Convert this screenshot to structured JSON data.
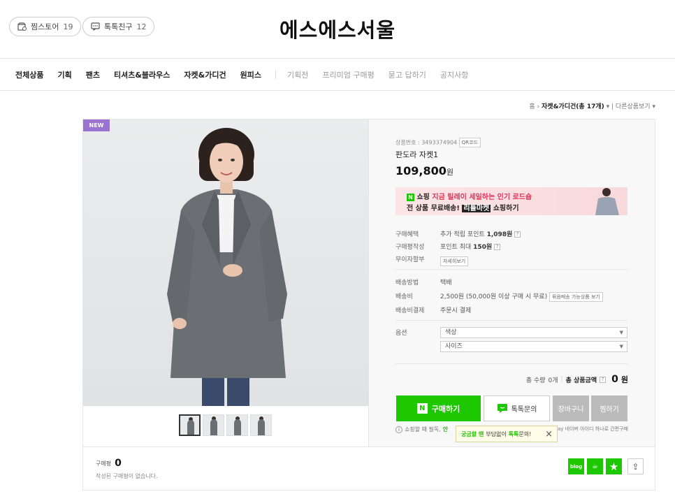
{
  "header": {
    "store_title": "에스에스서울",
    "pills": [
      {
        "label": "찜스토어",
        "count": "19",
        "icon": "store-icon"
      },
      {
        "label": "톡톡친구",
        "count": "12",
        "icon": "talk-icon"
      }
    ]
  },
  "nav": {
    "items": [
      "전체상품",
      "기획",
      "팬츠",
      "티셔츠&블라우스",
      "자켓&가디건",
      "원피스"
    ],
    "sub_items": [
      "기획전",
      "프리미엄 구매평",
      "묻고 답하기",
      "공지사항"
    ]
  },
  "breadcrumb": {
    "home": "홈",
    "category": "자켓&가디건(총",
    "count": "17개)",
    "other": "다른상품보기"
  },
  "gallery": {
    "badge": "NEW",
    "thumbnail_count": 4,
    "selected_thumbnail": 1
  },
  "product": {
    "number_label": "상품번호 : 3493374904",
    "qr_label": "QR코드",
    "name": "판도라 자켓1",
    "price": "109,800",
    "price_unit": "원"
  },
  "banner": {
    "line1_prefix": "쇼핑",
    "line1_highlight": "지금 릴레이 세일하는 인기 로드숍",
    "line2_prefix": "전 상품 무료배송!",
    "line2_highlight": "리틀마켓",
    "line2_suffix": "쇼핑하기"
  },
  "benefits": [
    {
      "label": "구매혜택",
      "text": "추가 적립 포인트",
      "bold": "1,098원",
      "help": "?"
    },
    {
      "label": "구매평작성",
      "text": "포인트 최대",
      "bold": "150원",
      "help": "?"
    },
    {
      "label": "무이자할부",
      "button": "자세히보기"
    }
  ],
  "shipping": [
    {
      "label": "배송방법",
      "text": "택배"
    },
    {
      "label": "배송비",
      "text": "2,500원 (50,000원 이상 구매 시 무료)",
      "button": "묶음배송 가능상품 보기"
    },
    {
      "label": "배송비결제",
      "text": "주문시 결제"
    }
  ],
  "options": {
    "label": "옵션",
    "selects": [
      "색상",
      "사이즈"
    ]
  },
  "totals": {
    "qty_label": "총 수량",
    "qty": "0개",
    "amount_label": "총 상품금액",
    "help": "?",
    "amount": "0",
    "amount_unit": "원"
  },
  "buttons": {
    "buy": "구매하기",
    "buy_icon": "N",
    "talk": "톡톡문의",
    "cart": "장바구니",
    "wish": "찜하기"
  },
  "notice": {
    "info_icon": "i",
    "text_start": "쇼핑할 때 필독,",
    "text_green": "안",
    "text_end": "pay 네이버 아이디 하나로 간편구매"
  },
  "tooltip": {
    "part1": "궁금할 땐",
    "part2": "부담없이",
    "part3": "톡톡",
    "part4": "문의!",
    "close": "×"
  },
  "reviews": {
    "label": "구매평",
    "count": "0",
    "empty": "작성된 구매평이 없습니다."
  },
  "social": [
    {
      "name": "blog-icon",
      "label": "blog"
    },
    {
      "name": "cafe-icon",
      "label": "☕"
    },
    {
      "name": "star-icon",
      "label": "★"
    }
  ],
  "share_icon": "⇪",
  "colors": {
    "naver_green": "#1ec800",
    "new_badge": "#9a73d1",
    "banner_pink": "#fde5e6",
    "tooltip_bg": "#fffde8"
  }
}
